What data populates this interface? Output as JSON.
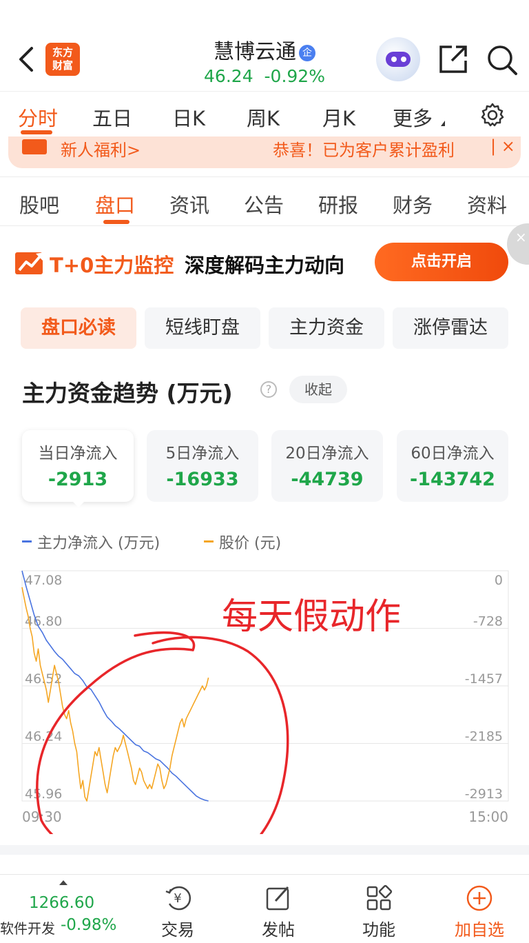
{
  "header": {
    "logo_text_line1": "东方",
    "logo_text_line2": "财富",
    "stock_name": "慧博云通",
    "verified_badge": "企",
    "price": "46.24",
    "change_pct": "-0.92%"
  },
  "chart_tabs": [
    {
      "label": "分时",
      "active": true
    },
    {
      "label": "五日"
    },
    {
      "label": "日K"
    },
    {
      "label": "周K"
    },
    {
      "label": "月K"
    },
    {
      "label": "更多"
    }
  ],
  "promo": {
    "left_text": "新人福利>",
    "right_text": "恭喜！已为客户累计盈利",
    "close": "| ×"
  },
  "section_tabs": [
    {
      "label": "股吧"
    },
    {
      "label": "盘口",
      "active": true
    },
    {
      "label": "资讯"
    },
    {
      "label": "公告"
    },
    {
      "label": "研报"
    },
    {
      "label": "财务"
    },
    {
      "label": "资料"
    }
  ],
  "banner": {
    "title_orange": "T+0主力监控",
    "title_black": "深度解码主力动向",
    "button": "点击开启",
    "corner_close": "×"
  },
  "pill_tabs": [
    {
      "label": "盘口必读",
      "active": true
    },
    {
      "label": "短线盯盘"
    },
    {
      "label": "主力资金"
    },
    {
      "label": "涨停雷达"
    }
  ],
  "trend": {
    "title": "主力资金趋势 (万元)",
    "help": "?",
    "collapse": "收起"
  },
  "flow_cards": [
    {
      "label": "当日净流入",
      "value": "-2913"
    },
    {
      "label": "5日净流入",
      "value": "-16933"
    },
    {
      "label": "20日净流入",
      "value": "-44739"
    },
    {
      "label": "60日净流入",
      "value": "-143742"
    }
  ],
  "legend": {
    "series1": "主力净流入 (万元)",
    "series2": "股价 (元)"
  },
  "colors": {
    "brand_orange": "#f25a1b",
    "down_green": "#1fa64a",
    "flow_line": "#4a74e0",
    "price_line": "#f5a623",
    "annotation_red": "#e8262a"
  },
  "annotation": "每天假动作",
  "chart_data": {
    "type": "line",
    "x_start": "09:30",
    "x_end": "15:00",
    "y_left_ticks": [
      "47.08",
      "46.80",
      "46.52",
      "46.24",
      "45.96"
    ],
    "y_right_ticks": [
      "0",
      "-728",
      "-1457",
      "-2185",
      "-2913"
    ],
    "y_left_range": [
      45.96,
      47.08
    ],
    "y_right_range": [
      -2913,
      0
    ],
    "x_points": 241,
    "series": [
      {
        "name": "主力净流入 (万元)",
        "axis": "right",
        "color": "#4a74e0",
        "x": [
          0,
          2,
          4,
          6,
          8,
          10,
          12,
          14,
          16,
          18,
          20,
          22,
          24,
          26,
          28,
          30,
          32,
          34,
          36,
          38,
          40,
          42,
          44,
          46,
          48,
          50,
          52,
          54,
          56,
          58,
          60,
          62,
          64,
          66,
          68,
          70,
          72,
          74,
          76,
          78,
          80,
          82,
          84,
          86,
          88,
          90,
          92
        ],
        "values": [
          0,
          -200,
          -380,
          -560,
          -700,
          -780,
          -880,
          -950,
          -1020,
          -1080,
          -1120,
          -1180,
          -1240,
          -1300,
          -1330,
          -1390,
          -1470,
          -1500,
          -1580,
          -1660,
          -1760,
          -1850,
          -1900,
          -1960,
          -2000,
          -2050,
          -2100,
          -2150,
          -2200,
          -2220,
          -2280,
          -2300,
          -2340,
          -2380,
          -2400,
          -2450,
          -2500,
          -2560,
          -2600,
          -2650,
          -2700,
          -2750,
          -2800,
          -2850,
          -2880,
          -2900,
          -2913
        ]
      },
      {
        "name": "股价 (元)",
        "axis": "left",
        "color": "#f5a623",
        "x": [
          0,
          1,
          2,
          3,
          4,
          5,
          6,
          7,
          8,
          9,
          10,
          11,
          12,
          13,
          14,
          15,
          16,
          17,
          18,
          19,
          20,
          21,
          22,
          23,
          24,
          25,
          26,
          27,
          28,
          29,
          30,
          31,
          32,
          33,
          34,
          35,
          36,
          37,
          38,
          39,
          40,
          41,
          42,
          43,
          44,
          45,
          46,
          47,
          48,
          49,
          50,
          51,
          52,
          53,
          54,
          55,
          56,
          57,
          58,
          59,
          60,
          61,
          62,
          63,
          64,
          65,
          66,
          67,
          68,
          69,
          70,
          71,
          72,
          73,
          74,
          75,
          76,
          77,
          78,
          79,
          80,
          81,
          82,
          83,
          84,
          85,
          86,
          87,
          88,
          89,
          90,
          91,
          92
        ],
        "values": [
          47.0,
          46.95,
          46.9,
          46.86,
          46.8,
          46.76,
          46.68,
          46.64,
          46.7,
          46.62,
          46.58,
          46.54,
          46.5,
          46.44,
          46.5,
          46.56,
          46.62,
          46.58,
          46.54,
          46.48,
          46.42,
          46.38,
          46.36,
          46.4,
          46.34,
          46.3,
          46.24,
          46.2,
          46.1,
          46.02,
          46.06,
          45.98,
          45.96,
          46.02,
          46.08,
          46.14,
          46.2,
          46.18,
          46.22,
          46.16,
          46.1,
          46.04,
          46.0,
          46.06,
          46.12,
          46.18,
          46.22,
          46.2,
          46.22,
          46.24,
          46.28,
          46.24,
          46.2,
          46.16,
          46.12,
          46.06,
          46.04,
          46.08,
          46.12,
          46.1,
          46.06,
          46.04,
          46.02,
          46.04,
          46.02,
          46.06,
          46.1,
          46.14,
          46.12,
          46.06,
          46.02,
          46.04,
          46.08,
          46.12,
          46.18,
          46.22,
          46.26,
          46.3,
          46.34,
          46.36,
          46.32,
          46.36,
          46.38,
          46.4,
          46.42,
          46.44,
          46.46,
          46.48,
          46.5,
          46.52,
          46.5,
          46.52,
          46.56
        ]
      }
    ],
    "grid": true
  },
  "bottom_nav": {
    "index_value": "1266.60",
    "index_name": "软件开发",
    "index_change": "-0.98%",
    "items": [
      {
        "label": "交易",
        "icon": "yuan-trade-icon"
      },
      {
        "label": "发帖",
        "icon": "edit-post-icon"
      },
      {
        "label": "功能",
        "icon": "grid-function-icon"
      },
      {
        "label": "加自选",
        "icon": "plus-circle-icon"
      }
    ]
  }
}
